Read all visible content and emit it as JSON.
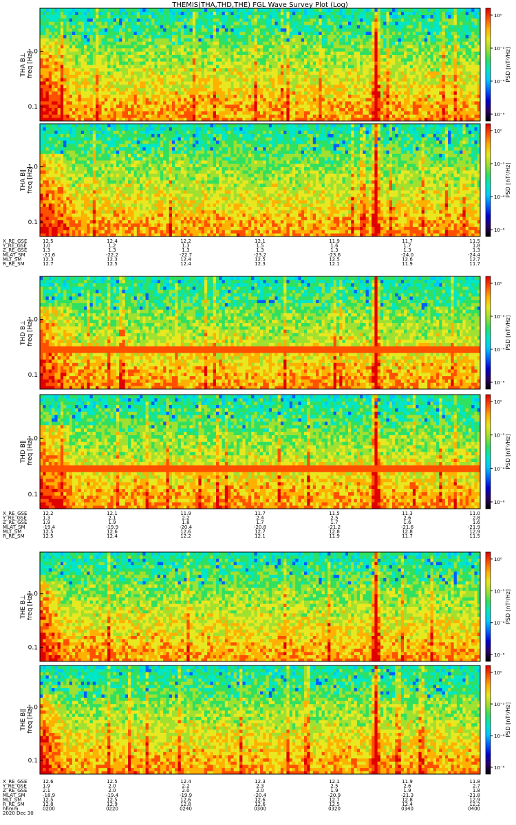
{
  "title": "THEMIS(THA,THD,THE) FGL Wave Survey Plot (Log)",
  "colors": {
    "colormap": [
      "#000000",
      "#2b0066",
      "#0000d0",
      "#0060ff",
      "#00c8ff",
      "#00e6c8",
      "#30e060",
      "#a0e030",
      "#e8e820",
      "#ffb000",
      "#ff5000",
      "#e00000"
    ]
  },
  "chart_data": [
    {
      "type": "heatmap",
      "probe": "THA",
      "ylabel_top": "THA B⊥",
      "ylabel_bottom": "freq [Hz]",
      "yscale": "log",
      "ylim": [
        0.055,
        6.0
      ],
      "yticks": [
        "1.0",
        "0.1"
      ],
      "cbar_label": "PSD [nT²/Hz]",
      "cbar_ticks": [
        "10⁰",
        "10⁻²",
        "10⁻⁴",
        "10⁻⁶"
      ],
      "features": {
        "burst_x": 0.05,
        "spike_x": 0.76,
        "band_freq": null
      }
    },
    {
      "type": "heatmap",
      "probe": "THA",
      "ylabel_top": "THA B∥",
      "ylabel_bottom": "freq [Hz]",
      "yscale": "log",
      "ylim": [
        0.055,
        6.0
      ],
      "yticks": [
        "1.0",
        "0.1"
      ],
      "cbar_label": "PSD [nT²/Hz]",
      "cbar_ticks": [
        "10⁰",
        "10⁻²",
        "10⁻⁴",
        "10⁻⁶"
      ],
      "features": {
        "burst_x": 0.05,
        "spike_x": 0.76,
        "band_freq": null
      }
    },
    {
      "type": "heatmap",
      "probe": "THD",
      "ylabel_top": "THD B⊥",
      "ylabel_bottom": "freq [Hz]",
      "yscale": "log",
      "ylim": [
        0.055,
        6.0
      ],
      "yticks": [
        "1.0",
        "0.1"
      ],
      "cbar_label": "PSD [nT²/Hz]",
      "cbar_ticks": [
        "10⁰",
        "10⁻²",
        "10⁻⁴",
        "10⁻⁶"
      ],
      "features": {
        "burst_x": 0.05,
        "spike_x": 0.76,
        "band_freq": 0.3
      }
    },
    {
      "type": "heatmap",
      "probe": "THD",
      "ylabel_top": "THD B∥",
      "ylabel_bottom": "freq [Hz]",
      "yscale": "log",
      "ylim": [
        0.055,
        6.0
      ],
      "yticks": [
        "1.0",
        "0.1"
      ],
      "cbar_label": "PSD [nT²/Hz]",
      "cbar_ticks": [
        "10⁰",
        "10⁻²",
        "10⁻⁴",
        "10⁻⁶"
      ],
      "features": {
        "burst_x": 0.05,
        "spike_x": 0.76,
        "band_freq": 0.3
      }
    },
    {
      "type": "heatmap",
      "probe": "THE",
      "ylabel_top": "THE B⊥",
      "ylabel_bottom": "freq [Hz]",
      "yscale": "log",
      "ylim": [
        0.055,
        6.0
      ],
      "yticks": [
        "1.0",
        "0.1"
      ],
      "cbar_label": "PSD [nT²/Hz]",
      "cbar_ticks": [
        "10⁰",
        "10⁻²",
        "10⁻⁴",
        "10⁻⁶"
      ],
      "features": {
        "burst_x": 0.03,
        "spike_x": 0.76,
        "band_freq": null
      }
    },
    {
      "type": "heatmap",
      "probe": "THE",
      "ylabel_top": "THE B∥",
      "ylabel_bottom": "freq [Hz]",
      "yscale": "log",
      "ylim": [
        0.055,
        6.0
      ],
      "yticks": [
        "1.0",
        "0.1"
      ],
      "cbar_label": "PSD [nT²/Hz]",
      "cbar_ticks": [
        "10⁰",
        "10⁻²",
        "10⁻⁴",
        "10⁻⁶"
      ],
      "features": {
        "burst_x": 0.03,
        "spike_x": 0.76,
        "band_freq": null
      }
    }
  ],
  "ephemeris_blocks": [
    {
      "labels": [
        "X_RE_GSE",
        "Y_RE_GSE",
        "Z_RE_GSE",
        "MLAT_SM",
        "MLT_SM",
        "R_RE_SM"
      ],
      "columns": [
        [
          "12.5",
          "1.0",
          "1.3",
          "-21.6",
          "12.3",
          "12.7"
        ],
        [
          "12.4",
          "1.2",
          "1.3",
          "-22.2",
          "12.3",
          "12.5"
        ],
        [
          "12.2",
          "1.3",
          "1.3",
          "-22.7",
          "12.4",
          "12.4"
        ],
        [
          "12.1",
          "1.5",
          "1.3",
          "-23.2",
          "12.5",
          "12.3"
        ],
        [
          "11.9",
          "1.6",
          "1.3",
          "-23.6",
          "12.5",
          "12.1"
        ],
        [
          "11.7",
          "1.7",
          "1.3",
          "-24.0",
          "12.6",
          "11.9"
        ],
        [
          "11.5",
          "1.8",
          "1.3",
          "-24.4",
          "12.7",
          "11.7"
        ]
      ]
    },
    {
      "labels": [
        "X_RE_GSE",
        "Y_RE_GSE",
        "Z_RE_GSE",
        "MLAT_SM",
        "MLT_SM",
        "R_RE_SM"
      ],
      "columns": [
        [
          "12.2",
          "1.3",
          "1.9",
          "-19.4",
          "12.5",
          "12.5"
        ],
        [
          "12.1",
          "2.1",
          "1.9",
          "-19.9",
          "12.6",
          "12.4"
        ],
        [
          "11.9",
          "2.2",
          "1.8",
          "-20.4",
          "12.6",
          "12.2"
        ],
        [
          "11.7",
          "2.4",
          "1.7",
          "-20.8",
          "12.7",
          "12.1"
        ],
        [
          "11.5",
          "2.5",
          "1.7",
          "-21.2",
          "12.8",
          "11.9"
        ],
        [
          "11.3",
          "2.6",
          "1.6",
          "-21.6",
          "12.8",
          "11.7"
        ],
        [
          "11.0",
          "2.8",
          "1.6",
          "-21.9",
          "12.9",
          "11.5"
        ]
      ]
    },
    {
      "labels": [
        "X_RE_GSE",
        "Y_RE_GSE",
        "Z_RE_GSE",
        "MLAT_SM",
        "MLT_SM",
        "R_RE_SM",
        "hhmm",
        "2020 Dec 30"
      ],
      "columns": [
        [
          "12.6",
          "1.9",
          "2.1",
          "-18.9",
          "12.5",
          "12.8",
          "0200"
        ],
        [
          "12.5",
          "2.0",
          "2.0",
          "-19.4",
          "12.5",
          "12.9",
          "0220"
        ],
        [
          "12.4",
          "2.2",
          "2.0",
          "-19.9",
          "12.6",
          "12.8",
          "0240"
        ],
        [
          "12.3",
          "2.3",
          "2.0",
          "-20.4",
          "12.6",
          "12.6",
          "0300"
        ],
        [
          "12.1",
          "2.5",
          "1.9",
          "-20.9",
          "12.7",
          "12.5",
          "0320"
        ],
        [
          "11.9",
          "2.6",
          "1.9",
          "-21.3",
          "12.8",
          "12.4",
          "0340"
        ],
        [
          "11.8",
          "2.7",
          "1.8",
          "-21.8",
          "12.9",
          "12.2",
          "0400"
        ]
      ]
    }
  ]
}
